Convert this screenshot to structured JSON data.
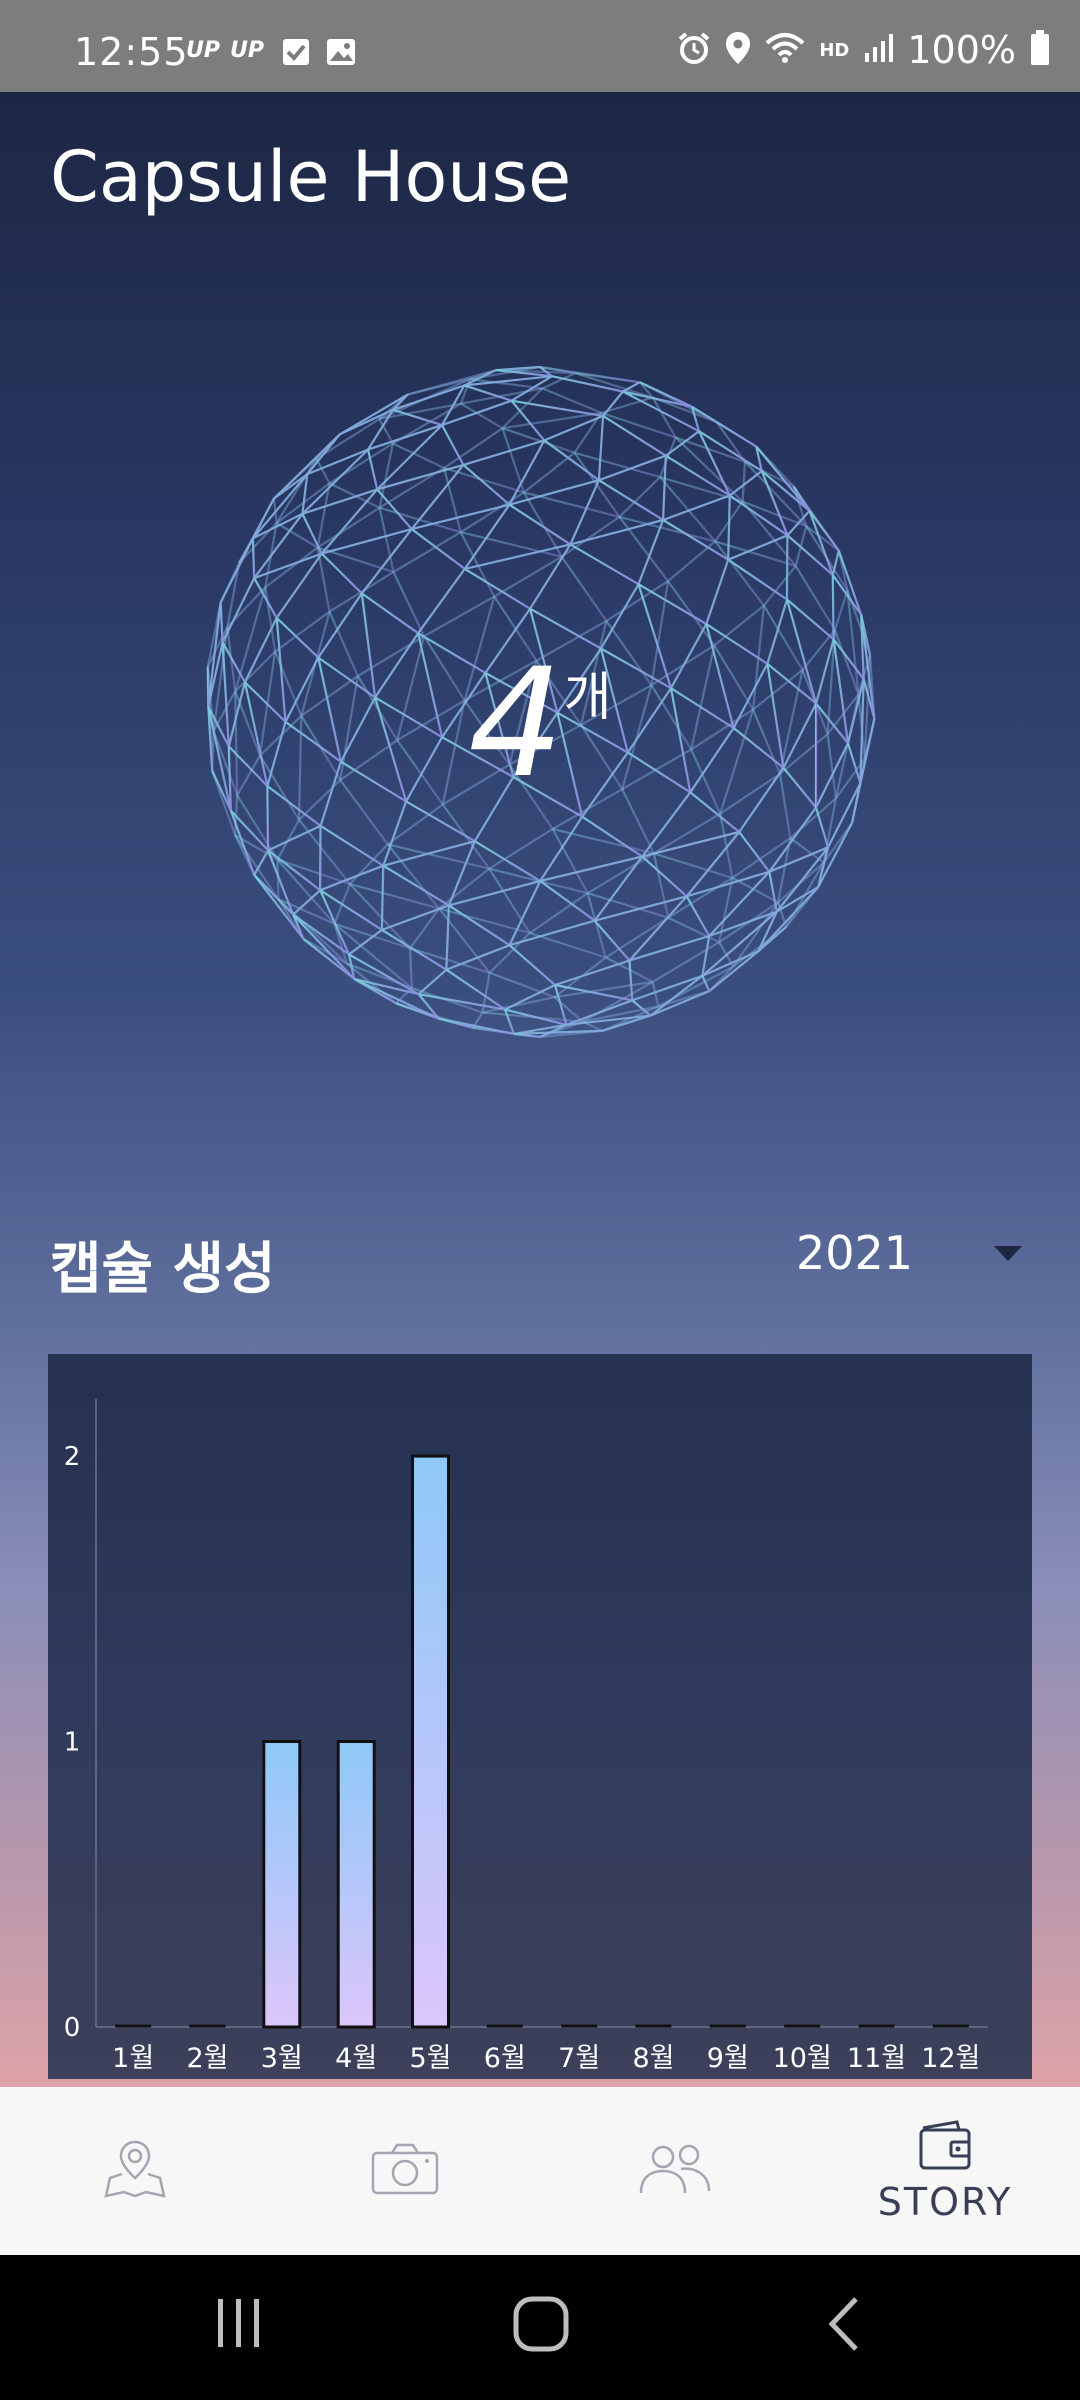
{
  "status_bar": {
    "time": "12:55",
    "left_chips": [
      "UP",
      "UP"
    ],
    "battery": "100%",
    "icons": [
      "check-box-icon",
      "image-icon",
      "alarm-icon",
      "location-icon",
      "wifi-icon",
      "hd-voice-icon",
      "signal-icon",
      "battery-icon"
    ],
    "hd_voice": "HD"
  },
  "app": {
    "title": "Capsule House",
    "capsule_count": "4",
    "capsule_unit": "개",
    "section_title": "캡슐 생성",
    "year": "2021"
  },
  "chart_data": {
    "type": "bar",
    "categories": [
      "1월",
      "2월",
      "3월",
      "4월",
      "5월",
      "6월",
      "7월",
      "8월",
      "9월",
      "10월",
      "11월",
      "12월"
    ],
    "values": [
      0,
      0,
      1,
      1,
      2,
      0,
      0,
      0,
      0,
      0,
      0,
      0
    ],
    "ylim": [
      0,
      2.2
    ],
    "yticks": [
      "0",
      "1",
      "2"
    ],
    "bar_gradient": [
      "#8ec8f8",
      "#dcc6fb"
    ]
  },
  "bottom_nav": {
    "items": [
      {
        "icon": "map-pin-icon",
        "label": ""
      },
      {
        "icon": "camera-icon",
        "label": ""
      },
      {
        "icon": "people-icon",
        "label": ""
      },
      {
        "icon": "wallet-icon",
        "label": "STORY"
      }
    ]
  },
  "system_nav": {
    "icons": [
      "recent-apps-icon",
      "home-icon",
      "back-icon"
    ]
  }
}
